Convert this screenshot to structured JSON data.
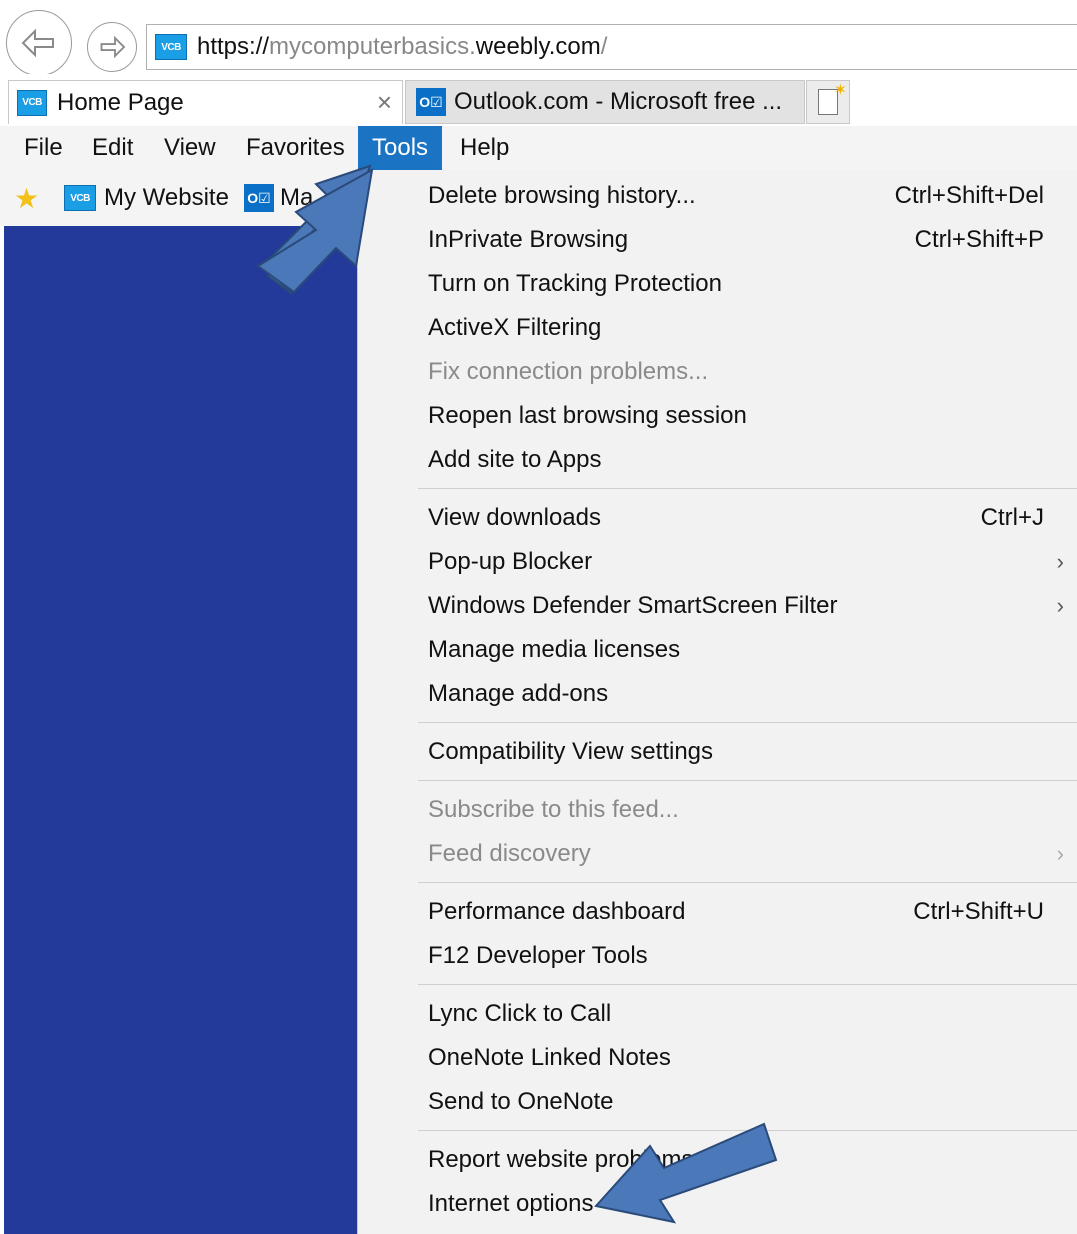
{
  "browser": {
    "url_prefix": "https://",
    "url_dim": "mycomputerbasics.",
    "url_domain": "weebly.com",
    "url_path": "/",
    "site_icon": "VCB"
  },
  "tabs": [
    {
      "label": "Home Page",
      "icon": "vcb-icon",
      "active": true
    },
    {
      "label": "Outlook.com - Microsoft free ...",
      "icon": "outlook-icon",
      "active": false
    }
  ],
  "menubar": {
    "items": [
      "File",
      "Edit",
      "View",
      "Favorites",
      "Tools",
      "Help"
    ],
    "active": "Tools"
  },
  "favorites": {
    "my_website": "My Website",
    "outlook_short": "Ma"
  },
  "tools_menu": {
    "items": [
      {
        "label": "Delete browsing history...",
        "shortcut": "Ctrl+Shift+Del"
      },
      {
        "label": "InPrivate Browsing",
        "shortcut": "Ctrl+Shift+P"
      },
      {
        "label": "Turn on Tracking Protection"
      },
      {
        "label": "ActiveX Filtering"
      },
      {
        "label": "Fix connection problems...",
        "disabled": true
      },
      {
        "label": "Reopen last browsing session"
      },
      {
        "label": "Add site to Apps"
      },
      {
        "label": "View downloads",
        "shortcut": "Ctrl+J"
      },
      {
        "label": "Pop-up Blocker",
        "submenu": true
      },
      {
        "label": "Windows Defender SmartScreen Filter",
        "submenu": true
      },
      {
        "label": "Manage media licenses"
      },
      {
        "label": "Manage add-ons"
      },
      {
        "label": "Compatibility View settings"
      },
      {
        "label": "Subscribe to this feed...",
        "disabled": true
      },
      {
        "label": "Feed discovery",
        "disabled": true,
        "submenu": true
      },
      {
        "label": "Performance dashboard",
        "shortcut": "Ctrl+Shift+U"
      },
      {
        "label": "F12 Developer Tools"
      },
      {
        "label": "Lync Click to Call"
      },
      {
        "label": "OneNote Linked Notes"
      },
      {
        "label": "Send to OneNote"
      },
      {
        "label": "Report website problems"
      },
      {
        "label": "Internet options"
      }
    ]
  },
  "colors": {
    "menu_active": "#1b73c4",
    "page_background": "#243a9a",
    "annotation_arrow": "#4a78b8"
  }
}
